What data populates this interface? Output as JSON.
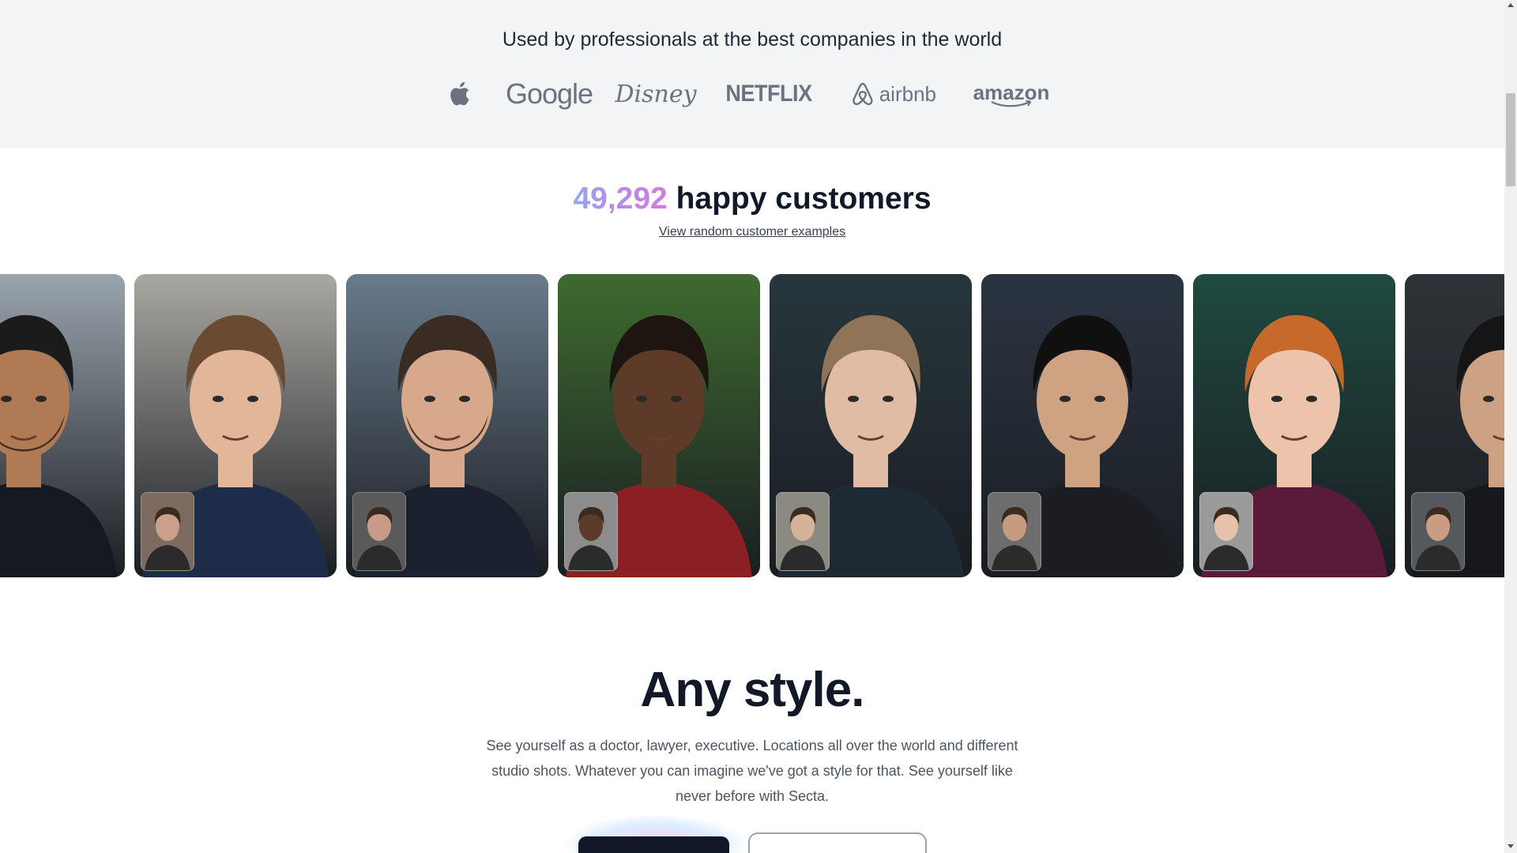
{
  "trust": {
    "title": "Used by professionals at the best companies in the world",
    "logos": [
      {
        "name": "apple-logo-icon",
        "text": ""
      },
      {
        "name": "google",
        "text": "Google"
      },
      {
        "name": "disney",
        "text": "Disney"
      },
      {
        "name": "netflix",
        "text": "NETFLIX"
      },
      {
        "name": "airbnb",
        "text": "airbnb"
      },
      {
        "name": "amazon",
        "text": "amazon"
      }
    ]
  },
  "customers": {
    "count": "49,292",
    "heading_rest": " happy customers",
    "link": "View random customer examples"
  },
  "style_section": {
    "title": "Any style.",
    "description": "See yourself as a doctor, lawyer, executive. Locations all over the world and different studio shots. Whatever you can imagine we've got a style for that. See yourself like never before with Secta."
  },
  "colors": {
    "count_gradient": [
      "#93a8f0",
      "#b98be8",
      "#d37ae0"
    ],
    "page_band": "#f3f4f6",
    "heading": "#111827"
  },
  "carousel_cards": [
    {
      "name": "customer-portrait-1",
      "bg": "#9aa4ad",
      "skin": "#b07a55",
      "hair": "#1b1b1b",
      "shirt": "#151a22",
      "beard": true,
      "thumb": false
    },
    {
      "name": "customer-portrait-2",
      "bg": "#a9a7a1",
      "skin": "#e2b699",
      "hair": "#6a4a30",
      "shirt": "#1d2c48",
      "beard": false,
      "thumb": true,
      "thumb_bg": "#7d6b62",
      "thumb_skin": "#c9a08a"
    },
    {
      "name": "customer-portrait-3",
      "bg": "#6a7b8c",
      "skin": "#d7a88a",
      "hair": "#3a2c22",
      "shirt": "#1a2230",
      "beard": true,
      "thumb": true,
      "thumb_bg": "#5a5a5a",
      "thumb_skin": "#c79b85"
    },
    {
      "name": "customer-portrait-4",
      "bg": "#3e6b2f",
      "skin": "#5e3a28",
      "hair": "#1f1510",
      "shirt": "#8a1f24",
      "beard": false,
      "thumb": true,
      "thumb_bg": "#8c8c8c",
      "thumb_skin": "#5c3b2c"
    },
    {
      "name": "customer-portrait-5",
      "bg": "#27373d",
      "skin": "#e1bca5",
      "hair": "#8f7458",
      "shirt": "#1e2a33",
      "beard": false,
      "thumb": true,
      "thumb_bg": "#8a8a80",
      "thumb_skin": "#d6b29a"
    },
    {
      "name": "customer-portrait-6",
      "bg": "#2b3542",
      "skin": "#cfa281",
      "hair": "#101010",
      "shirt": "#1b1d22",
      "beard": false,
      "thumb": true,
      "thumb_bg": "#6d6d6d",
      "thumb_skin": "#c69c80"
    },
    {
      "name": "customer-portrait-7",
      "bg": "#1f4a40",
      "skin": "#edc3ab",
      "hair": "#c8692c",
      "shirt": "#5a1a3a",
      "beard": false,
      "thumb": true,
      "thumb_bg": "#9a9a9a",
      "thumb_skin": "#e6c2ac"
    },
    {
      "name": "customer-portrait-8",
      "bg": "#2f3338",
      "skin": "#cda283",
      "hair": "#151515",
      "shirt": "#16181c",
      "beard": false,
      "thumb": true,
      "thumb_bg": "#55585c",
      "thumb_skin": "#c89d82"
    }
  ]
}
